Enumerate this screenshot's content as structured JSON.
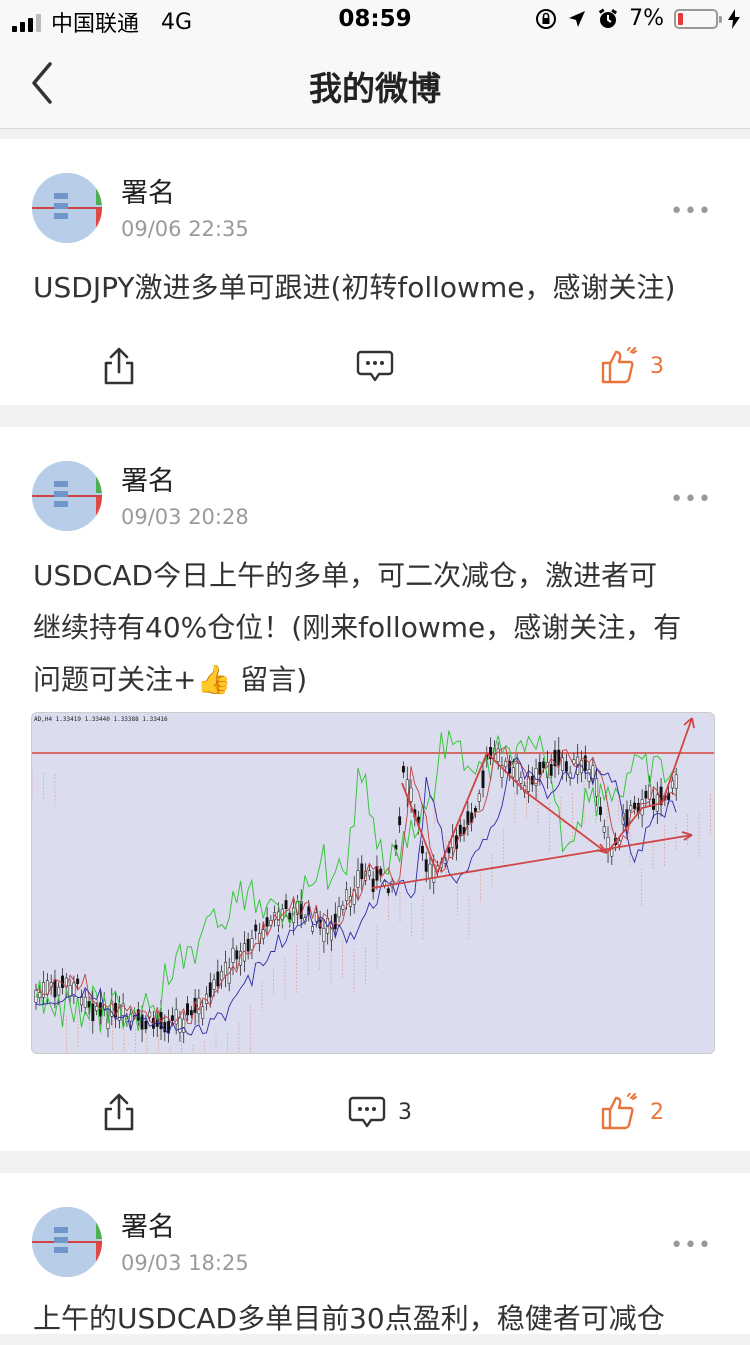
{
  "status_bar": {
    "carrier": "中国联通",
    "network": "4G",
    "time": "08:59",
    "battery": "7%",
    "battery_level": 0.07
  },
  "nav": {
    "title": "我的微博"
  },
  "posts": [
    {
      "author": "署名",
      "time": "09/06 22:35",
      "text_lines": [
        "USDJPY激进多单可跟进(初转followme，感谢关注)"
      ],
      "comments": "",
      "likes": "3"
    },
    {
      "author": "署名",
      "time": "09/03 20:28",
      "text_lines": [
        "USDCAD今日上午的多单，可二次减仓，激进者可",
        "继续持有40%仓位！(刚来followme，感谢关注，有",
        "问题可关注+"
      ],
      "emoji": "👍",
      "text_tail": " 留言)",
      "chart_header": "AD,H4  1.33419 1.33440 1.33388 1.33416",
      "comments": "3",
      "likes": "2"
    },
    {
      "author": "署名",
      "time": "09/03 18:25",
      "text_lines": [
        "上午的USDCAD多单目前30点盈利，稳健者可减仓"
      ]
    }
  ],
  "colors": {
    "accent": "#e8753c",
    "text": "#333333",
    "meta": "#9a9a9a",
    "chart_bg": "#dcdcef"
  }
}
